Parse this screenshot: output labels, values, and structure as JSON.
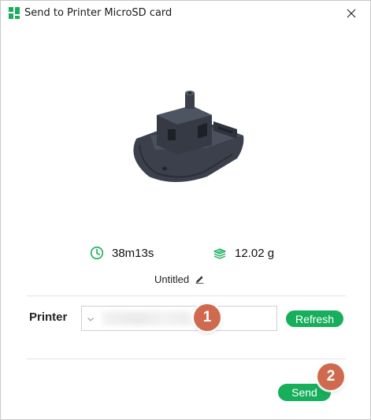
{
  "window": {
    "title": "Send to Printer MicroSD card"
  },
  "stats": {
    "time": "38m13s",
    "weight": "12.02 g"
  },
  "plate": {
    "name": "Untitled"
  },
  "printer": {
    "label": "Printer",
    "refresh_label": "Refresh"
  },
  "actions": {
    "send_label": "Send"
  },
  "callouts": [
    "1",
    "2"
  ],
  "colors": {
    "accent": "#17ae5c",
    "callout": "#cf6a4e",
    "model": "#3a3f4b"
  },
  "icons": {
    "app": "app-logo-icon",
    "close": "close-icon",
    "time": "clock-icon",
    "weight": "filament-weight-icon",
    "edit": "pencil-icon",
    "select": "chevron-down-icon"
  }
}
